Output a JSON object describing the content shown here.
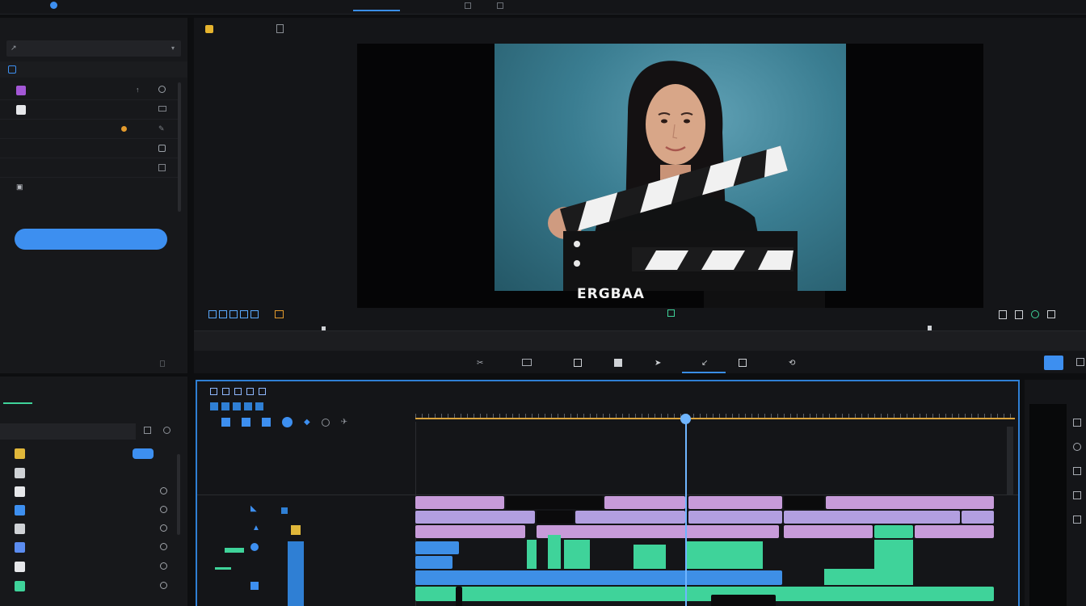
{
  "topbar": {
    "active_tab": ""
  },
  "left_panel": {
    "title": "",
    "dropdown_value": "",
    "section_label": "",
    "rows": [
      {
        "label": "",
        "color": "#a357d6"
      },
      {
        "label": "",
        "color": "#e6e7ea"
      },
      {
        "label": "",
        "color": ""
      },
      {
        "label": "",
        "color": ""
      },
      {
        "label": "",
        "color": ""
      },
      {
        "label": "",
        "color": ""
      }
    ],
    "footer_label": "",
    "apply_button": ""
  },
  "preview": {
    "tab_label": "",
    "slate_text": "ERGBAA",
    "scrub_label": ""
  },
  "lower_panel": {
    "tabs": [
      "",
      "",
      "",
      "",
      ""
    ],
    "search_value": "",
    "items": [
      {
        "label": "",
        "color": "#e0b73a"
      },
      {
        "label": "",
        "color": "#cfd2d6"
      },
      {
        "label": "",
        "color": "#e6e7ea"
      },
      {
        "label": "",
        "color": "#3d8ff0"
      },
      {
        "label": "",
        "color": "#cfd2d6"
      },
      {
        "label": "",
        "color": "#5b8cf0"
      },
      {
        "label": "",
        "color": "#e6e7ea"
      },
      {
        "label": "",
        "color": "#3fd39a"
      }
    ]
  },
  "timeline": {
    "header_label": "",
    "ruler_label": ""
  },
  "right_panel": {
    "title": ""
  },
  "colors": {
    "accent": "#3d8ff0",
    "playhead": "#6fb5ff",
    "ruler": "#d9a23b"
  }
}
